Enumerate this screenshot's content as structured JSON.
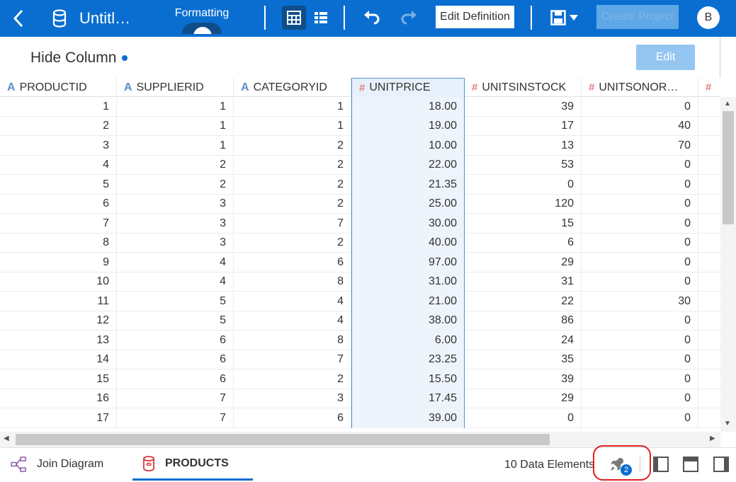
{
  "toolbar": {
    "title": "Untitl…",
    "formatting_label": "Formatting",
    "edit_definition_label": "Edit Definition",
    "create_project_label": "Create Project",
    "avatar_initial": "B"
  },
  "panel": {
    "title": "Hide Column",
    "edit_label": "Edit"
  },
  "grid": {
    "columns": [
      {
        "name": "PRODUCTID",
        "type": "A"
      },
      {
        "name": "SUPPLIERID",
        "type": "A"
      },
      {
        "name": "CATEGORYID",
        "type": "A"
      },
      {
        "name": "UNITPRICE",
        "type": "#"
      },
      {
        "name": "UNITSINSTOCK",
        "type": "#"
      },
      {
        "name": "UNITSONOR…",
        "type": "#"
      }
    ],
    "rows": [
      [
        "1",
        "1",
        "1",
        "18.00",
        "39",
        "0"
      ],
      [
        "2",
        "1",
        "1",
        "19.00",
        "17",
        "40"
      ],
      [
        "3",
        "1",
        "2",
        "10.00",
        "13",
        "70"
      ],
      [
        "4",
        "2",
        "2",
        "22.00",
        "53",
        "0"
      ],
      [
        "5",
        "2",
        "2",
        "21.35",
        "0",
        "0"
      ],
      [
        "6",
        "3",
        "2",
        "25.00",
        "120",
        "0"
      ],
      [
        "7",
        "3",
        "7",
        "30.00",
        "15",
        "0"
      ],
      [
        "8",
        "3",
        "2",
        "40.00",
        "6",
        "0"
      ],
      [
        "9",
        "4",
        "6",
        "97.00",
        "29",
        "0"
      ],
      [
        "10",
        "4",
        "8",
        "31.00",
        "31",
        "0"
      ],
      [
        "11",
        "5",
        "4",
        "21.00",
        "22",
        "30"
      ],
      [
        "12",
        "5",
        "4",
        "38.00",
        "86",
        "0"
      ],
      [
        "13",
        "6",
        "8",
        "6.00",
        "24",
        "0"
      ],
      [
        "14",
        "6",
        "7",
        "23.25",
        "35",
        "0"
      ],
      [
        "15",
        "6",
        "2",
        "15.50",
        "39",
        "0"
      ],
      [
        "16",
        "7",
        "3",
        "17.45",
        "29",
        "0"
      ],
      [
        "17",
        "7",
        "6",
        "39.00",
        "0",
        "0"
      ]
    ]
  },
  "bottom": {
    "tab_join": "Join Diagram",
    "tab_products": "PRODUCTS",
    "elements_count": "10 Data Elements",
    "rocket_badge": "2"
  },
  "colors": {
    "toolbar_bg": "#0a6ed1",
    "accent": "#0a6ed1",
    "highlight_ring": "#e02020"
  }
}
